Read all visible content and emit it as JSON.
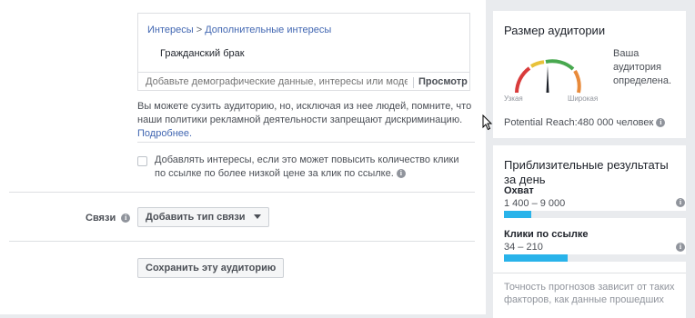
{
  "targeting": {
    "breadcrumb_parent": "Интересы",
    "breadcrumb_sep": ">",
    "breadcrumb_child": "Дополнительные интересы",
    "selected_interest": "Гражданский брак",
    "search_placeholder": "Добавьте демографические данные, интересы или модели ...",
    "browse_label": "Просмотр"
  },
  "narrow_note": {
    "text": "Вы можете сузить аудиторию, но, исключая из нее людей, помните, что наши политики рекламной деятельности запрещают дискриминацию.",
    "more_link": "Подробнее."
  },
  "expand_interests": {
    "checked": false,
    "text": "Добавлять интересы, если это может повысить количество клики по ссылке по более низкой цене за клик по ссылке.",
    "info_icon": "info-icon"
  },
  "connections": {
    "label": "Связи",
    "button_label": "Добавить тип связи",
    "info_icon": "info-icon"
  },
  "save_button": "Сохранить эту аудиторию",
  "audience_size": {
    "title": "Размер аудитории",
    "gauge_narrow": "Узкая",
    "gauge_broad": "Широкая",
    "status": "Ваша аудитория определена.",
    "potential_reach_label": "Potential Reach:",
    "potential_reach_value": "480 000 человек",
    "gauge_position": 0.5
  },
  "estimated_results": {
    "title": "Приблизительные результаты за день",
    "reach_title": "Охват",
    "reach_value": "1 400 – 9 000",
    "reach_fill": 0.15,
    "clicks_title": "Клики по ссылке",
    "clicks_value": "34 – 210",
    "clicks_fill": 0.35,
    "footnote": "Точность прогнозов зависит от таких факторов, как данные прошедших"
  },
  "colors": {
    "link": "#4267b2",
    "progress": "#29b3ea",
    "gauge_red": "#d93b3b",
    "gauge_yellow": "#e8c23a",
    "gauge_green": "#48a84f"
  }
}
